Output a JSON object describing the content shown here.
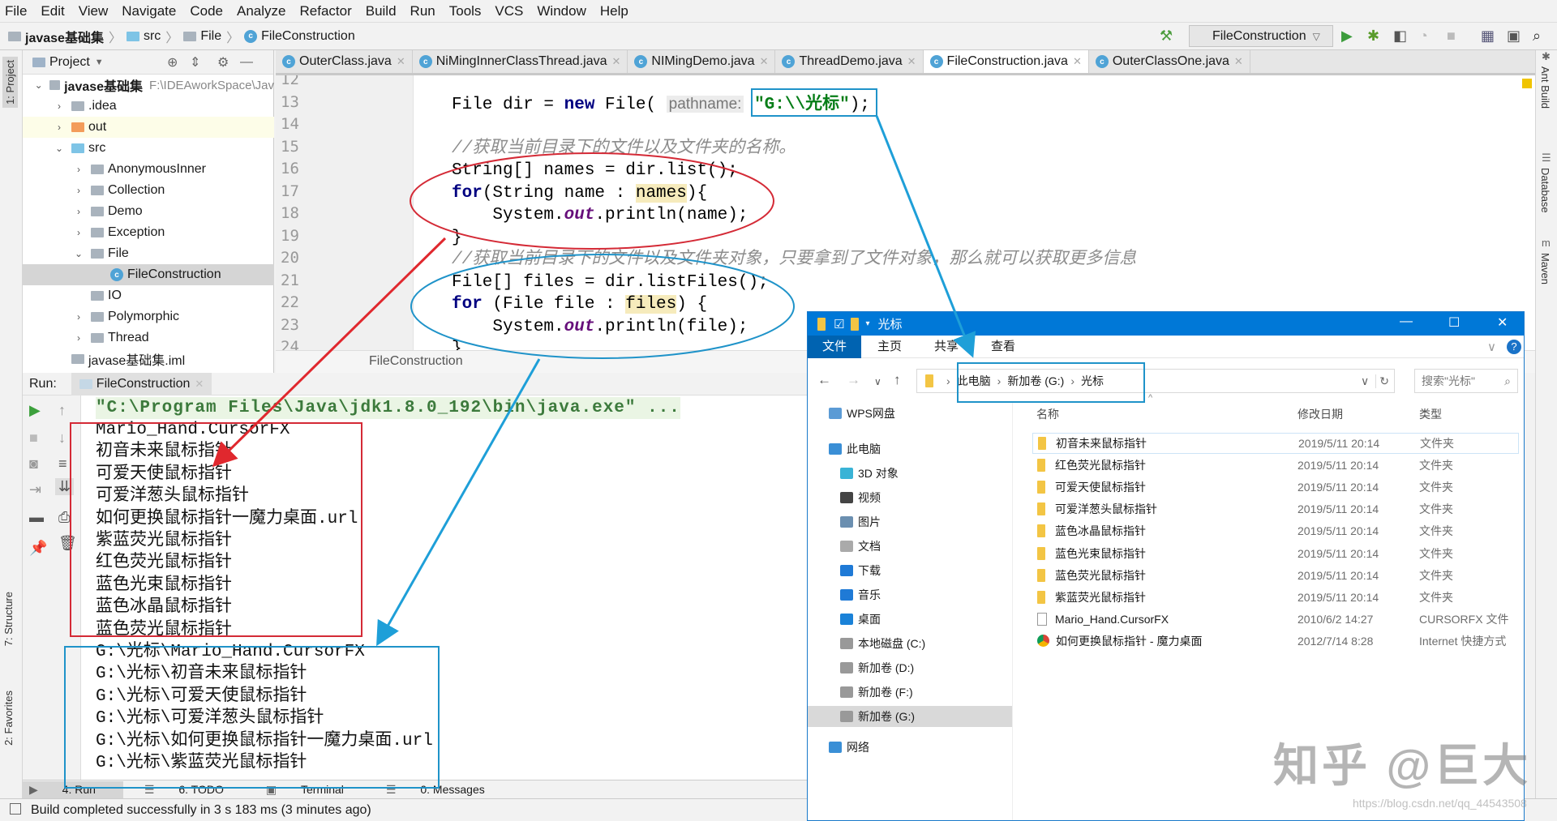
{
  "menu": [
    "File",
    "Edit",
    "View",
    "Navigate",
    "Code",
    "Analyze",
    "Refactor",
    "Build",
    "Run",
    "Tools",
    "VCS",
    "Window",
    "Help"
  ],
  "breadcrumb": [
    "javase基础集",
    "src",
    "File",
    "FileConstruction"
  ],
  "toolbar": {
    "run_config": "FileConstruction"
  },
  "left_strip": {
    "project": "1: Project",
    "structure": "7: Structure",
    "favorites": "2: Favorites"
  },
  "right_strip": [
    "Ant Build",
    "Database",
    "Maven"
  ],
  "project": {
    "title": "Project",
    "tree": [
      {
        "label": "javase基础集",
        "path": "F:\\IDEAworkSpace\\Jav",
        "arrow": "open",
        "icon": "module",
        "level": 0
      },
      {
        "label": ".idea",
        "arrow": "closed",
        "icon": "folder",
        "level": 1
      },
      {
        "label": "out",
        "arrow": "closed",
        "icon": "folder-orange",
        "level": 1
      },
      {
        "label": "src",
        "arrow": "open",
        "icon": "folder-blue",
        "level": 1
      },
      {
        "label": "AnonymousInner",
        "arrow": "closed",
        "icon": "package",
        "level": 2
      },
      {
        "label": "Collection",
        "arrow": "closed",
        "icon": "package",
        "level": 2
      },
      {
        "label": "Demo",
        "arrow": "closed",
        "icon": "package",
        "level": 2
      },
      {
        "label": "Exception",
        "arrow": "closed",
        "icon": "package",
        "level": 2
      },
      {
        "label": "File",
        "arrow": "open",
        "icon": "package",
        "level": 2
      },
      {
        "label": "FileConstruction",
        "arrow": "none",
        "icon": "class",
        "level": 3,
        "selected": true
      },
      {
        "label": "IO",
        "arrow": "none",
        "icon": "package",
        "level": 2
      },
      {
        "label": "Polymorphic",
        "arrow": "closed",
        "icon": "package",
        "level": 2
      },
      {
        "label": "Thread",
        "arrow": "closed",
        "icon": "package",
        "level": 2
      },
      {
        "label": "javase基础集.iml",
        "arrow": "none",
        "icon": "iml",
        "level": 1
      }
    ]
  },
  "tabs": [
    {
      "label": "OuterClass.java"
    },
    {
      "label": "NiMingInnerClassThread.java"
    },
    {
      "label": "NIMingDemo.java"
    },
    {
      "label": "ThreadDemo.java"
    },
    {
      "label": "FileConstruction.java",
      "active": true
    },
    {
      "label": "OuterClassOne.java"
    }
  ],
  "editor": {
    "lines": [
      {
        "n": "12",
        "seg": []
      },
      {
        "n": "13",
        "seg": [
          {
            "t": "File dir = "
          },
          {
            "t": "new",
            "c": "kw"
          },
          {
            "t": " File( "
          },
          {
            "t": "pathname:",
            "c": "hint"
          },
          {
            "t": " "
          },
          {
            "t": "\"G:\\\\光标\"",
            "c": "str"
          },
          {
            "t": ");"
          }
        ]
      },
      {
        "n": "14",
        "seg": []
      },
      {
        "n": "15",
        "seg": [
          {
            "t": "//获取当前目录下的文件以及文件夹的名称。",
            "c": "cm"
          }
        ]
      },
      {
        "n": "16",
        "seg": [
          {
            "t": "String[] names = dir.list();"
          }
        ]
      },
      {
        "n": "17",
        "seg": [
          {
            "t": "for",
            "c": "kw"
          },
          {
            "t": "(String name : "
          },
          {
            "t": "names",
            "c": "hl"
          },
          {
            "t": "){"
          }
        ]
      },
      {
        "n": "18",
        "seg": [
          {
            "t": "    System."
          },
          {
            "t": "out",
            "c": "fld"
          },
          {
            "t": ".println(name);"
          }
        ]
      },
      {
        "n": "19",
        "seg": [
          {
            "t": "}"
          }
        ]
      },
      {
        "n": "20",
        "seg": [
          {
            "t": "//获取当前目录下的文件以及文件夹对象，只要拿到了文件对象，那么就可以获取更多信息",
            "c": "cm"
          }
        ]
      },
      {
        "n": "21",
        "seg": [
          {
            "t": "File[] files = dir.listFiles();"
          }
        ]
      },
      {
        "n": "22",
        "seg": [
          {
            "t": "for",
            "c": "kw"
          },
          {
            "t": " (File file : "
          },
          {
            "t": "files",
            "c": "hl"
          },
          {
            "t": ") {"
          }
        ]
      },
      {
        "n": "23",
        "seg": [
          {
            "t": "    System."
          },
          {
            "t": "out",
            "c": "fld"
          },
          {
            "t": ".println(file);"
          }
        ]
      },
      {
        "n": "24",
        "seg": [
          {
            "t": "}"
          }
        ]
      }
    ],
    "footer_crumb": "FileConstruction"
  },
  "run": {
    "label": "Run:",
    "tab": "FileConstruction",
    "command": "\"C:\\Program Files\\Java\\jdk1.8.0_192\\bin\\java.exe\" ...",
    "output": [
      "Mario_Hand.CursorFX",
      "初音未来鼠标指针",
      "可爱天使鼠标指针",
      "可爱洋葱头鼠标指针",
      "如何更换鼠标指针一魔力桌面.url",
      "紫蓝荧光鼠标指针",
      "红色荧光鼠标指针",
      "蓝色光束鼠标指针",
      "蓝色冰晶鼠标指针",
      "蓝色荧光鼠标指针",
      "G:\\光标\\Mario_Hand.CursorFX",
      "G:\\光标\\初音未来鼠标指针",
      "G:\\光标\\可爱天使鼠标指针",
      "G:\\光标\\可爱洋葱头鼠标指针",
      "G:\\光标\\如何更换鼠标指针一魔力桌面.url",
      "G:\\光标\\紫蓝荧光鼠标指针"
    ]
  },
  "bottom_tabs": [
    "4: Run",
    "6: TODO",
    "Terminal",
    "0: Messages"
  ],
  "status": "Build completed successfully in 3 s 183 ms (3 minutes ago)",
  "explorer": {
    "title": "光标",
    "ribbon": [
      "文件",
      "主页",
      "共享",
      "查看"
    ],
    "address": [
      "此电脑",
      "新加卷 (G:)",
      "光标"
    ],
    "search_placeholder": "搜索\"光标\"",
    "columns": [
      "名称",
      "修改日期",
      "类型"
    ],
    "nav": [
      {
        "label": "WPS网盘",
        "icon": "cloud",
        "level": 0
      },
      {
        "label": "此电脑",
        "icon": "pc",
        "level": 0
      },
      {
        "label": "3D 对象",
        "icon": "cube",
        "level": 1
      },
      {
        "label": "视频",
        "icon": "video",
        "level": 1
      },
      {
        "label": "图片",
        "icon": "picture",
        "level": 1
      },
      {
        "label": "文档",
        "icon": "document",
        "level": 1
      },
      {
        "label": "下载",
        "icon": "download",
        "level": 1
      },
      {
        "label": "音乐",
        "icon": "music",
        "level": 1
      },
      {
        "label": "桌面",
        "icon": "desktop",
        "level": 1
      },
      {
        "label": "本地磁盘 (C:)",
        "icon": "drive",
        "level": 1
      },
      {
        "label": "新加卷 (D:)",
        "icon": "drive",
        "level": 1
      },
      {
        "label": "新加卷 (F:)",
        "icon": "drive",
        "level": 1
      },
      {
        "label": "新加卷 (G:)",
        "icon": "drive",
        "level": 1,
        "selected": true
      },
      {
        "label": "网络",
        "icon": "network",
        "level": 0
      }
    ],
    "files": [
      {
        "name": "初音未来鼠标指针",
        "date": "2019/5/11 20:14",
        "type": "文件夹",
        "icon": "folder"
      },
      {
        "name": "红色荧光鼠标指针",
        "date": "2019/5/11 20:14",
        "type": "文件夹",
        "icon": "folder"
      },
      {
        "name": "可爱天使鼠标指针",
        "date": "2019/5/11 20:14",
        "type": "文件夹",
        "icon": "folder"
      },
      {
        "name": "可爱洋葱头鼠标指针",
        "date": "2019/5/11 20:14",
        "type": "文件夹",
        "icon": "folder"
      },
      {
        "name": "蓝色冰晶鼠标指针",
        "date": "2019/5/11 20:14",
        "type": "文件夹",
        "icon": "folder"
      },
      {
        "name": "蓝色光束鼠标指针",
        "date": "2019/5/11 20:14",
        "type": "文件夹",
        "icon": "folder"
      },
      {
        "name": "蓝色荧光鼠标指针",
        "date": "2019/5/11 20:14",
        "type": "文件夹",
        "icon": "folder"
      },
      {
        "name": "紫蓝荧光鼠标指针",
        "date": "2019/5/11 20:14",
        "type": "文件夹",
        "icon": "folder"
      },
      {
        "name": "Mario_Hand.CursorFX",
        "date": "2010/6/2 14:27",
        "type": "CURSORFX 文件",
        "icon": "file"
      },
      {
        "name": "如何更换鼠标指针 - 魔力桌面",
        "date": "2012/7/14 8:28",
        "type": "Internet 快捷方式",
        "icon": "chrome"
      }
    ]
  },
  "watermark": "知乎 @巨大",
  "csdn_watermark": "https://blog.csdn.net/qq_44543508",
  "colors": {
    "annotation_red": "#e0282e",
    "annotation_blue": "#1e9fd8",
    "explorer_blue": "#0078d7"
  }
}
